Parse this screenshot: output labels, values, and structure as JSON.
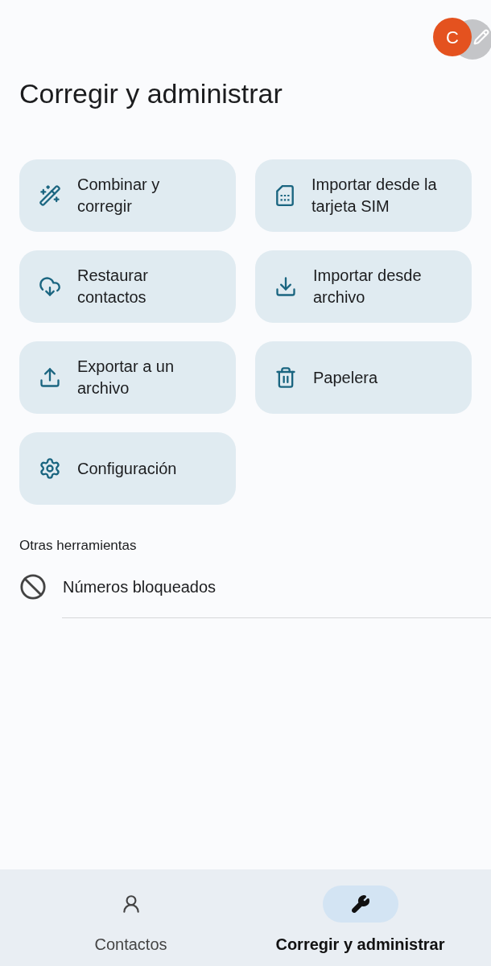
{
  "account": {
    "initial": "C",
    "color": "#e4521f"
  },
  "title": "Corregir y administrar",
  "actions": [
    {
      "kind": "merge",
      "label": "Combinar y corregir"
    },
    {
      "kind": "sim",
      "label": "Importar desde la tarjeta SIM"
    },
    {
      "kind": "restore",
      "label": "Restaurar contactos"
    },
    {
      "kind": "import",
      "label": "Importar desde archivo"
    },
    {
      "kind": "export",
      "label": "Exportar a un archivo"
    },
    {
      "kind": "trash",
      "label": "Papelera"
    },
    {
      "kind": "settings",
      "label": "Configuración"
    }
  ],
  "other_tools": {
    "heading": "Otras herramientas",
    "items": [
      {
        "kind": "blocked",
        "label": "Números bloqueados"
      }
    ]
  },
  "bottom_nav": [
    {
      "kind": "contacts",
      "label": "Contactos",
      "selected": false
    },
    {
      "kind": "fix",
      "label": "Corregir y administrar",
      "selected": true
    }
  ]
}
